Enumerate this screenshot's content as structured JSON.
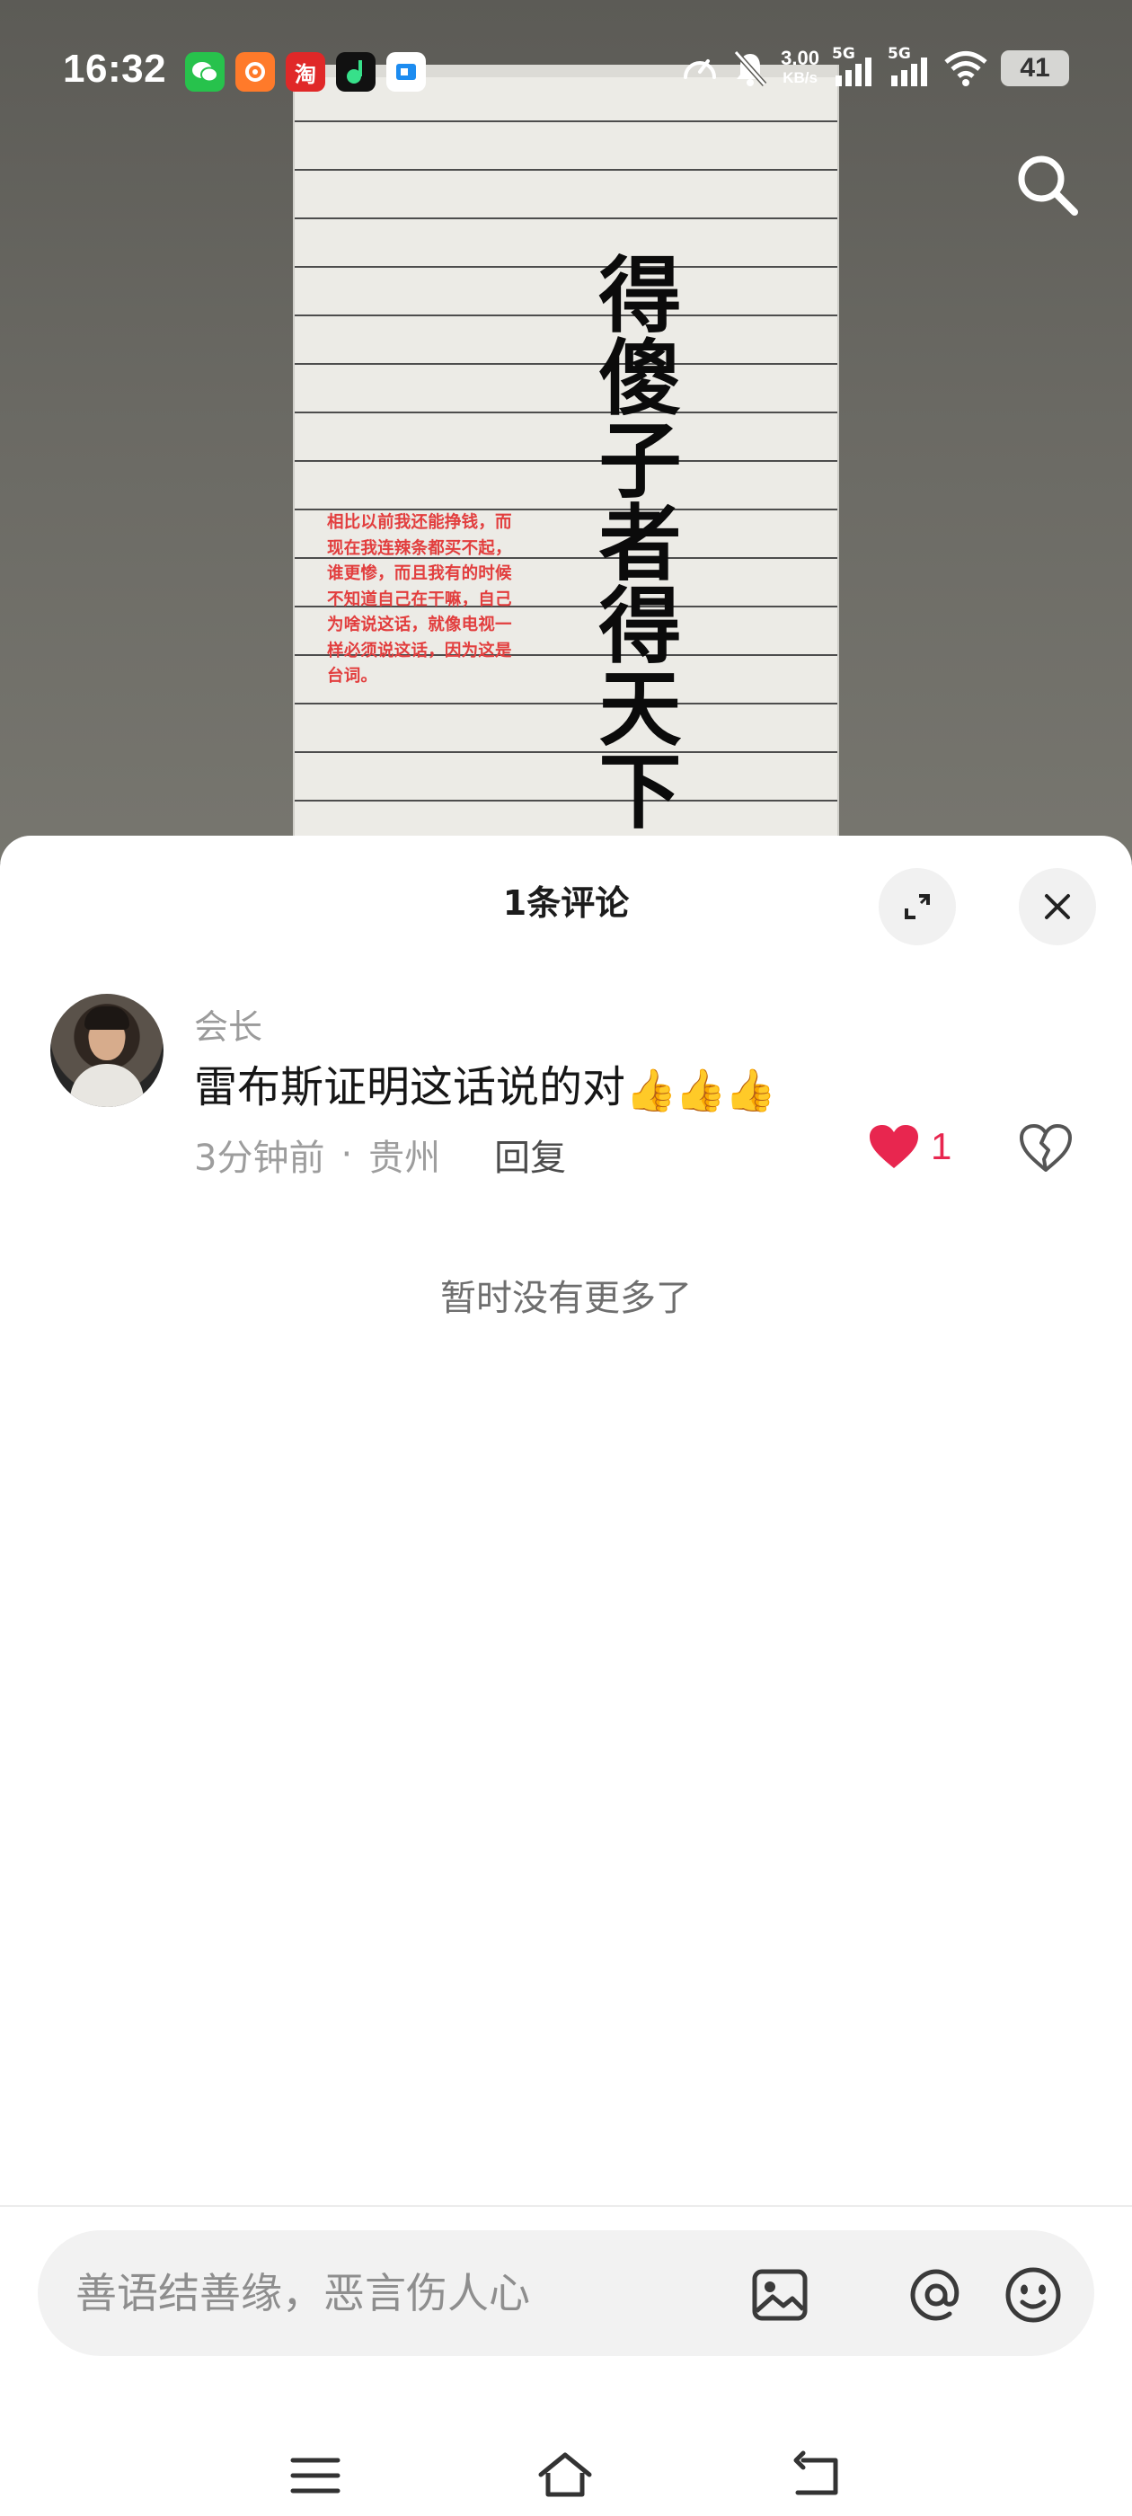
{
  "status_bar": {
    "time": "16:32",
    "app_icons": [
      {
        "name": "wechat-icon",
        "color": "#27c24c",
        "glyph": "✆"
      },
      {
        "name": "app-orange-icon",
        "color": "#ff7a2a",
        "glyph": "✿"
      },
      {
        "name": "taobao-icon",
        "color": "#e02828",
        "glyph": "淘"
      },
      {
        "name": "app-green-icon",
        "color": "#111111",
        "glyph": "●"
      },
      {
        "name": "app-blue-icon",
        "color": "#ffffff",
        "glyph": "■"
      }
    ],
    "network_speed": "3.00",
    "network_unit": "KB/s",
    "signal_label_1": "5G",
    "signal_label_2": "5G",
    "battery": "41"
  },
  "video": {
    "calligraphy": "得傻子者得天下",
    "note": "相比以前我还能挣钱，而现在我连辣条都买不起，谁更惨，而且我有的时候不知道自己在干嘛，自己为啥说这话，就像电视一样必须说这话，因为这是台词。"
  },
  "comments_sheet": {
    "title": "1条评论",
    "comments": [
      {
        "username": "会长",
        "text": "雷布斯证明这话说的对",
        "emoji": "👍👍👍",
        "time": "3分钟前",
        "separator": "·",
        "location": "贵州",
        "reply_label": "回复",
        "like_count": "1"
      }
    ],
    "no_more_text": "暂时没有更多了",
    "input_placeholder": "善语结善缘，恶言伤人心"
  },
  "colors": {
    "like_red": "#e8264f",
    "sheet_bg": "#ffffff"
  }
}
